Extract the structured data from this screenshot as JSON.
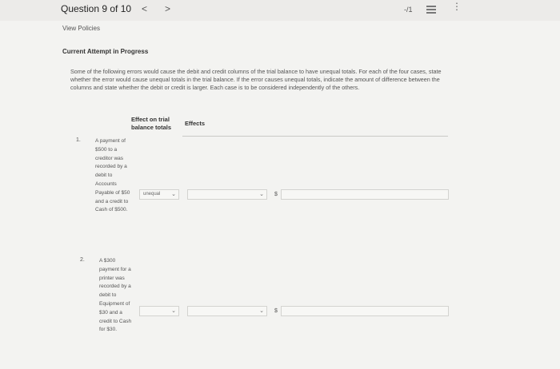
{
  "header": {
    "question_label": "Question 9 of 10",
    "prev_glyph": "<",
    "next_glyph": ">",
    "score": "-/1",
    "more_glyph": "⋮"
  },
  "links": {
    "view_policies": "View Policies"
  },
  "section_title": "Current Attempt in Progress",
  "instructions": "Some of the following errors would cause the debit and credit columns of the trial balance to have unequal totals. For each of the four cases, state whether the error would cause unequal totals in the trial balance. If the error causes unequal totals, indicate the amount of difference between the columns and state whether the debit or credit is larger. Each case is to be considered independently of the others.",
  "columns": {
    "effect": "Effect on trial balance totals",
    "effects": "Effects"
  },
  "cases": [
    {
      "number": "1.",
      "text": "A payment of $500 to a creditor was recorded by a debit to Accounts Payable of $50 and a credit to Cash of $500.",
      "effect_value": "unequal",
      "effects_value": "",
      "currency": "$",
      "amount": ""
    },
    {
      "number": "2.",
      "text": "A $300 payment for a printer was recorded by a debit to Equipment of $30 and a credit to Cash for $30.",
      "effect_value": "",
      "effects_value": "",
      "currency": "$",
      "amount": ""
    }
  ],
  "chevron": "⌄"
}
